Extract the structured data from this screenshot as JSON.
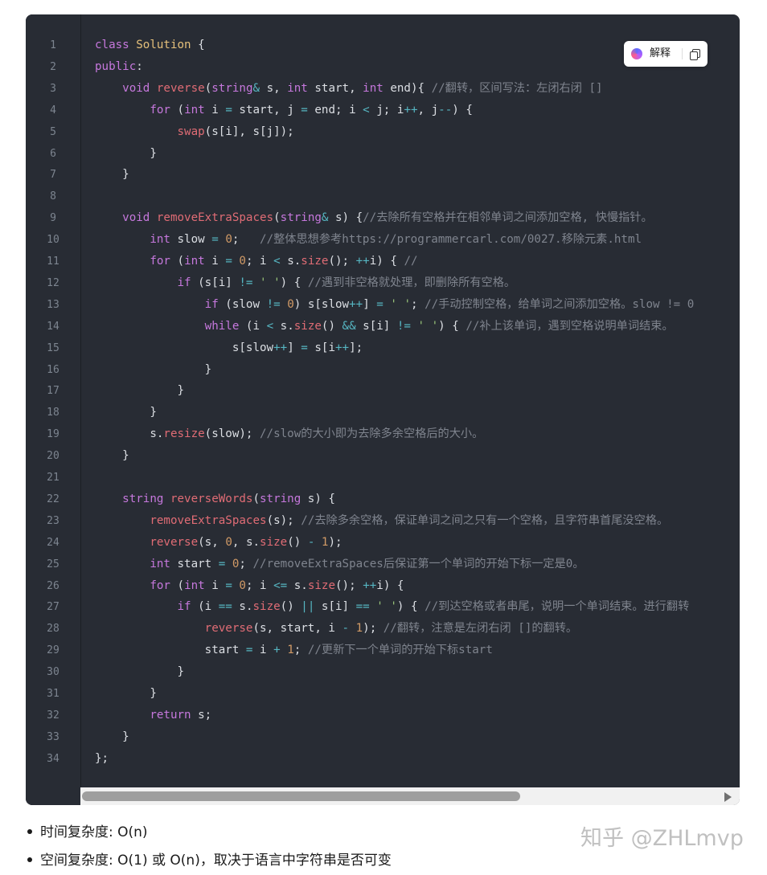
{
  "toolbar": {
    "explain_label": "解释",
    "explain_icon": "brain-icon",
    "copy_icon": "copy-icon"
  },
  "code": {
    "language": "C++",
    "line_numbers": [
      "1",
      "2",
      "3",
      "4",
      "5",
      "6",
      "7",
      "8",
      "9",
      "10",
      "11",
      "12",
      "13",
      "14",
      "15",
      "16",
      "17",
      "18",
      "19",
      "20",
      "21",
      "22",
      "23",
      "24",
      "25",
      "26",
      "27",
      "28",
      "29",
      "30",
      "31",
      "32",
      "33",
      "34"
    ],
    "lines": [
      [
        [
          "kw",
          "class"
        ],
        [
          "",
          ""
        ],
        [
          "cls",
          "Solution"
        ],
        [
          "",
          " {"
        ]
      ],
      [
        [
          "kw",
          "public"
        ],
        [
          "",
          ":"
        ]
      ],
      [
        [
          "",
          "    "
        ],
        [
          "kw",
          "void"
        ],
        [
          "",
          " "
        ],
        [
          "fn",
          "reverse"
        ],
        [
          "",
          "("
        ],
        [
          "kw",
          "string"
        ],
        [
          "op",
          "&"
        ],
        [
          "",
          " s, "
        ],
        [
          "kw",
          "int"
        ],
        [
          "",
          " start, "
        ],
        [
          "kw",
          "int"
        ],
        [
          "",
          " end){ "
        ],
        [
          "cm",
          "//翻转，区间写法：左闭右闭 []"
        ]
      ],
      [
        [
          "",
          "        "
        ],
        [
          "kw",
          "for"
        ],
        [
          "",
          " ("
        ],
        [
          "kw",
          "int"
        ],
        [
          "",
          " i "
        ],
        [
          "op",
          "="
        ],
        [
          "",
          " start, j "
        ],
        [
          "op",
          "="
        ],
        [
          "",
          " end; i "
        ],
        [
          "op",
          "<"
        ],
        [
          "",
          " j; i"
        ],
        [
          "op",
          "++"
        ],
        [
          "",
          ", j"
        ],
        [
          "op",
          "--"
        ],
        [
          "",
          ") {"
        ]
      ],
      [
        [
          "",
          "            "
        ],
        [
          "fn",
          "swap"
        ],
        [
          "",
          "(s[i], s[j]);"
        ]
      ],
      [
        [
          "",
          "        }"
        ]
      ],
      [
        [
          "",
          "    }"
        ]
      ],
      [
        [
          "",
          ""
        ]
      ],
      [
        [
          "",
          "    "
        ],
        [
          "kw",
          "void"
        ],
        [
          "",
          " "
        ],
        [
          "fn",
          "removeExtraSpaces"
        ],
        [
          "",
          "("
        ],
        [
          "kw",
          "string"
        ],
        [
          "op",
          "&"
        ],
        [
          "",
          " s) {"
        ],
        [
          "cm",
          "//去除所有空格并在相邻单词之间添加空格, 快慢指针。"
        ]
      ],
      [
        [
          "",
          "        "
        ],
        [
          "kw",
          "int"
        ],
        [
          "",
          " slow "
        ],
        [
          "op",
          "="
        ],
        [
          "",
          " "
        ],
        [
          "nm",
          "0"
        ],
        [
          "",
          ";   "
        ],
        [
          "cm",
          "//整体思想参考https://programmercarl.com/0027.移除元素.html"
        ]
      ],
      [
        [
          "",
          "        "
        ],
        [
          "kw",
          "for"
        ],
        [
          "",
          " ("
        ],
        [
          "kw",
          "int"
        ],
        [
          "",
          " i "
        ],
        [
          "op",
          "="
        ],
        [
          "",
          " "
        ],
        [
          "nm",
          "0"
        ],
        [
          "",
          "; i "
        ],
        [
          "op",
          "<"
        ],
        [
          "",
          " s."
        ],
        [
          "fn",
          "size"
        ],
        [
          "",
          "(); "
        ],
        [
          "op",
          "++"
        ],
        [
          "",
          "i) { "
        ],
        [
          "cm",
          "//"
        ]
      ],
      [
        [
          "",
          "            "
        ],
        [
          "kw",
          "if"
        ],
        [
          "",
          " (s[i] "
        ],
        [
          "op",
          "!="
        ],
        [
          "",
          " "
        ],
        [
          "st",
          "' '"
        ],
        [
          "",
          ") { "
        ],
        [
          "cm",
          "//遇到非空格就处理，即删除所有空格。"
        ]
      ],
      [
        [
          "",
          "                "
        ],
        [
          "kw",
          "if"
        ],
        [
          "",
          " (slow "
        ],
        [
          "op",
          "!="
        ],
        [
          "",
          " "
        ],
        [
          "nm",
          "0"
        ],
        [
          "",
          ") s[slow"
        ],
        [
          "op",
          "++"
        ],
        [
          "",
          "] "
        ],
        [
          "op",
          "="
        ],
        [
          "",
          " "
        ],
        [
          "st",
          "' '"
        ],
        [
          "",
          "; "
        ],
        [
          "cm",
          "//手动控制空格，给单词之间添加空格。slow != 0"
        ]
      ],
      [
        [
          "",
          "                "
        ],
        [
          "kw",
          "while"
        ],
        [
          "",
          " (i "
        ],
        [
          "op",
          "<"
        ],
        [
          "",
          " s."
        ],
        [
          "fn",
          "size"
        ],
        [
          "",
          "() "
        ],
        [
          "op",
          "&&"
        ],
        [
          "",
          " s[i] "
        ],
        [
          "op",
          "!="
        ],
        [
          "",
          " "
        ],
        [
          "st",
          "' '"
        ],
        [
          "",
          ") { "
        ],
        [
          "cm",
          "//补上该单词，遇到空格说明单词结束。"
        ]
      ],
      [
        [
          "",
          "                    s[slow"
        ],
        [
          "op",
          "++"
        ],
        [
          "",
          "] "
        ],
        [
          "op",
          "="
        ],
        [
          "",
          " s[i"
        ],
        [
          "op",
          "++"
        ],
        [
          "",
          "];"
        ]
      ],
      [
        [
          "",
          "                }"
        ]
      ],
      [
        [
          "",
          "            }"
        ]
      ],
      [
        [
          "",
          "        }"
        ]
      ],
      [
        [
          "",
          "        s."
        ],
        [
          "fn",
          "resize"
        ],
        [
          "",
          "(slow); "
        ],
        [
          "cm",
          "//slow的大小即为去除多余空格后的大小。"
        ]
      ],
      [
        [
          "",
          "    }"
        ]
      ],
      [
        [
          "",
          ""
        ]
      ],
      [
        [
          "",
          "    "
        ],
        [
          "kw",
          "string"
        ],
        [
          "",
          " "
        ],
        [
          "fn",
          "reverseWords"
        ],
        [
          "",
          "("
        ],
        [
          "kw",
          "string"
        ],
        [
          "",
          " s) {"
        ]
      ],
      [
        [
          "",
          "        "
        ],
        [
          "fn",
          "removeExtraSpaces"
        ],
        [
          "",
          "(s); "
        ],
        [
          "cm",
          "//去除多余空格，保证单词之间之只有一个空格，且字符串首尾没空格。"
        ]
      ],
      [
        [
          "",
          "        "
        ],
        [
          "fn",
          "reverse"
        ],
        [
          "",
          "(s, "
        ],
        [
          "nm",
          "0"
        ],
        [
          "",
          ", s."
        ],
        [
          "fn",
          "size"
        ],
        [
          "",
          "() "
        ],
        [
          "op",
          "-"
        ],
        [
          "",
          " "
        ],
        [
          "nm",
          "1"
        ],
        [
          "",
          ");"
        ]
      ],
      [
        [
          "",
          "        "
        ],
        [
          "kw",
          "int"
        ],
        [
          "",
          " start "
        ],
        [
          "op",
          "="
        ],
        [
          "",
          " "
        ],
        [
          "nm",
          "0"
        ],
        [
          "",
          "; "
        ],
        [
          "cm",
          "//removeExtraSpaces后保证第一个单词的开始下标一定是0。"
        ]
      ],
      [
        [
          "",
          "        "
        ],
        [
          "kw",
          "for"
        ],
        [
          "",
          " ("
        ],
        [
          "kw",
          "int"
        ],
        [
          "",
          " i "
        ],
        [
          "op",
          "="
        ],
        [
          "",
          " "
        ],
        [
          "nm",
          "0"
        ],
        [
          "",
          "; i "
        ],
        [
          "op",
          "<="
        ],
        [
          "",
          " s."
        ],
        [
          "fn",
          "size"
        ],
        [
          "",
          "(); "
        ],
        [
          "op",
          "++"
        ],
        [
          "",
          "i) {"
        ]
      ],
      [
        [
          "",
          "            "
        ],
        [
          "kw",
          "if"
        ],
        [
          "",
          " (i "
        ],
        [
          "op",
          "=="
        ],
        [
          "",
          " s."
        ],
        [
          "fn",
          "size"
        ],
        [
          "",
          "() "
        ],
        [
          "op",
          "||"
        ],
        [
          "",
          " s[i] "
        ],
        [
          "op",
          "=="
        ],
        [
          "",
          " "
        ],
        [
          "st",
          "' '"
        ],
        [
          "",
          ") { "
        ],
        [
          "cm",
          "//到达空格或者串尾，说明一个单词结束。进行翻转"
        ]
      ],
      [
        [
          "",
          "                "
        ],
        [
          "fn",
          "reverse"
        ],
        [
          "",
          "(s, start, i "
        ],
        [
          "op",
          "-"
        ],
        [
          "",
          " "
        ],
        [
          "nm",
          "1"
        ],
        [
          "",
          "); "
        ],
        [
          "cm",
          "//翻转，注意是左闭右闭 []的翻转。"
        ]
      ],
      [
        [
          "",
          "                start "
        ],
        [
          "op",
          "="
        ],
        [
          "",
          " i "
        ],
        [
          "op",
          "+"
        ],
        [
          "",
          " "
        ],
        [
          "nm",
          "1"
        ],
        [
          "",
          "; "
        ],
        [
          "cm",
          "//更新下一个单词的开始下标start"
        ]
      ],
      [
        [
          "",
          "            }"
        ]
      ],
      [
        [
          "",
          "        }"
        ]
      ],
      [
        [
          "",
          "        "
        ],
        [
          "kw",
          "return"
        ],
        [
          "",
          " s;"
        ]
      ],
      [
        [
          "",
          "    }"
        ]
      ],
      [
        [
          "",
          "};"
        ]
      ]
    ]
  },
  "bullets": [
    "时间复杂度: O(n)",
    "空间复杂度: O(1) 或 O(n)，取决于语言中字符串是否可变"
  ],
  "watermark": "知乎 @ZHLmvp"
}
